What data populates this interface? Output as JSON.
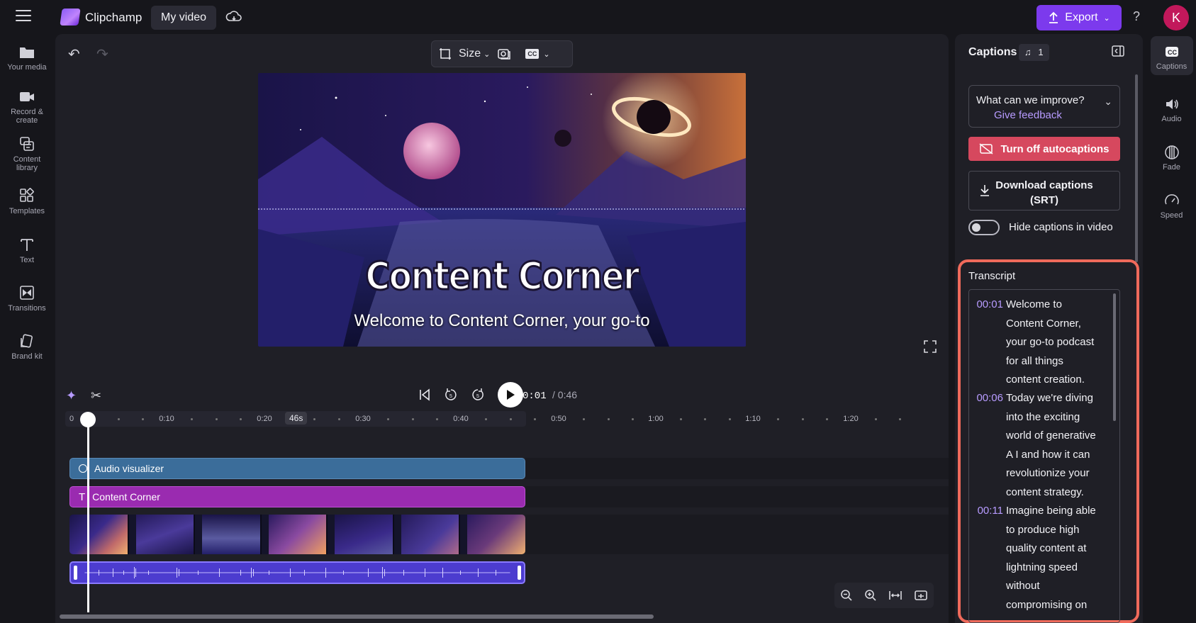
{
  "topbar": {
    "app_name": "Clipchamp",
    "video_name": "My video",
    "export_label": "Export",
    "help_glyph": "?",
    "avatar_initial": "K"
  },
  "leftnav": {
    "items": [
      {
        "label1": "Your media",
        "label2": "",
        "icon": "folder-icon"
      },
      {
        "label1": "Record &",
        "label2": "create",
        "icon": "camera-icon"
      },
      {
        "label1": "Content",
        "label2": "library",
        "icon": "library-icon"
      },
      {
        "label1": "Templates",
        "label2": "",
        "icon": "templates-icon"
      },
      {
        "label1": "Text",
        "label2": "",
        "icon": "text-icon"
      },
      {
        "label1": "Transitions",
        "label2": "",
        "icon": "transitions-icon"
      },
      {
        "label1": "Brand kit",
        "label2": "",
        "icon": "brand-kit-icon"
      }
    ]
  },
  "editor": {
    "size_label": "Size",
    "cc_label": "CC",
    "preview_title": "Content Corner",
    "preview_caption": "Welcome to Content Corner, your go-to"
  },
  "playback": {
    "current_time": "0:01",
    "total_time": "/ 0:46",
    "duration_badge": "46s"
  },
  "ruler": {
    "ticks": [
      "0",
      "0:10",
      "0:20",
      "0:30",
      "0:40",
      "0:50",
      "1:00",
      "1:10",
      "1:20"
    ]
  },
  "tracks": {
    "audio_label": "Audio visualizer",
    "text_label": "Content Corner"
  },
  "captions": {
    "header": "Captions",
    "badge_count": "1",
    "feedback_question": "What can we improve?",
    "feedback_link": "Give feedback",
    "autocaption_button": "Turn off autocaptions",
    "download_line1": "Download captions",
    "download_line2": "(SRT)",
    "hide_toggle_label": "Hide captions in video",
    "transcript_title": "Transcript",
    "transcript": [
      {
        "time": "00:01",
        "lines": [
          "Welcome to",
          "Content Corner,",
          "your go-to podcast",
          "for all things",
          "content creation."
        ]
      },
      {
        "time": "00:06",
        "lines": [
          "Today we're diving",
          "into the exciting",
          "world of generative",
          "A I and how it can",
          "revolutionize your",
          "content strategy."
        ]
      },
      {
        "time": "00:11",
        "lines": [
          "Imagine being able",
          "to produce high",
          "quality content at",
          "lightning speed",
          "without",
          "compromising on"
        ]
      }
    ]
  },
  "rightrail": {
    "items": [
      {
        "label": "Captions",
        "icon": "cc-icon"
      },
      {
        "label": "Audio",
        "icon": "speaker-icon"
      },
      {
        "label": "Fade",
        "icon": "fade-icon"
      },
      {
        "label": "Speed",
        "icon": "speed-icon"
      }
    ]
  },
  "colors": {
    "accent": "#7c3aed",
    "caption_button": "#d6485e",
    "transcript_time": "#b79bff",
    "highlight_outline": "#ef6a5b"
  }
}
